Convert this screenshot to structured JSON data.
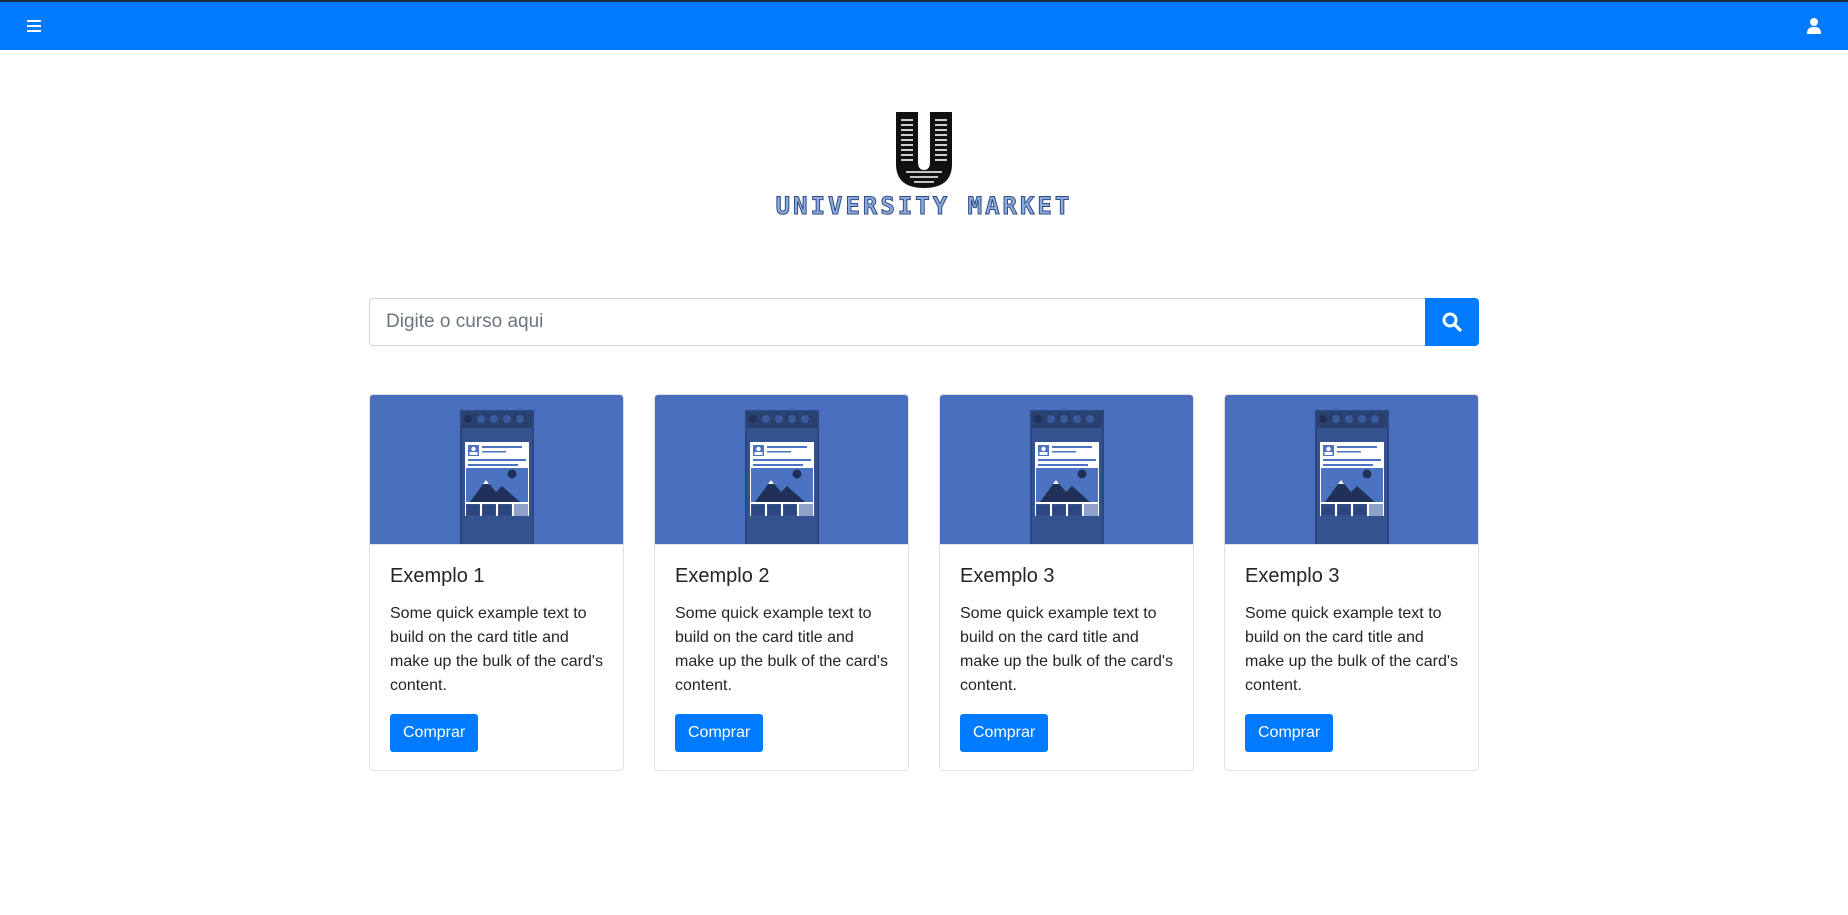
{
  "navbar": {
    "color": "#007bff",
    "menu_icon": "hamburger-icon",
    "user_icon": "user-icon"
  },
  "logo": {
    "text": "UNIVERSITY MARKET",
    "letter": "U"
  },
  "search": {
    "placeholder": "Digite o curso aqui",
    "value": "",
    "button_icon": "search-icon"
  },
  "cards": [
    {
      "title": "Exemplo 1",
      "text": "Some quick example text to build on the card title and make up the bulk of the card's content.",
      "button": "Comprar"
    },
    {
      "title": "Exemplo 2",
      "text": "Some quick example text to build on the card title and make up the bulk of the card's content.",
      "button": "Comprar"
    },
    {
      "title": "Exemplo 3",
      "text": "Some quick example text to build on the card title and make up the bulk of the card's content.",
      "button": "Comprar"
    },
    {
      "title": "Exemplo 3",
      "text": "Some quick example text to build on the card title and make up the bulk of the card's content.",
      "button": "Comprar"
    }
  ],
  "colors": {
    "primary": "#007bff",
    "card_image_bg": "#486ebd"
  }
}
